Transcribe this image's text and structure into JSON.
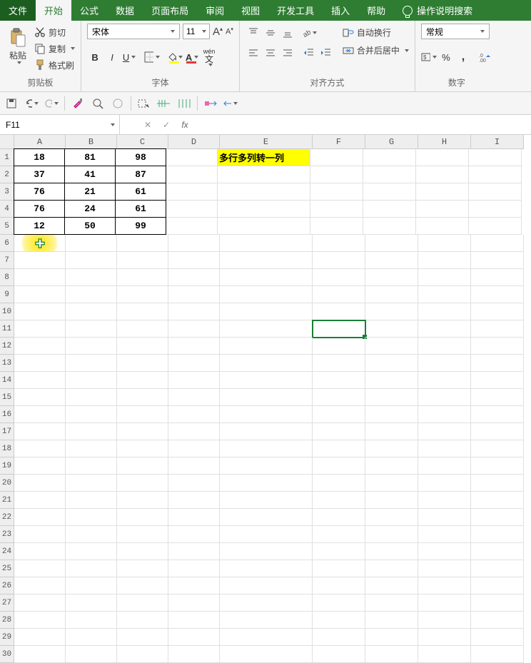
{
  "tabs": {
    "file": "文件",
    "home": "开始",
    "formula": "公式",
    "data": "数据",
    "layout": "页面布局",
    "review": "审阅",
    "view": "视图",
    "dev": "开发工具",
    "insert": "插入",
    "help": "帮助",
    "search": "操作说明搜索"
  },
  "ribbon": {
    "clipboard": {
      "paste": "粘贴",
      "cut": "剪切",
      "copy": "复制",
      "format_painter": "格式刷",
      "label": "剪贴板"
    },
    "font": {
      "name": "宋体",
      "size": "11",
      "wen": "wén",
      "label": "字体"
    },
    "align": {
      "wrap": "自动换行",
      "merge": "合并后居中",
      "label": "对齐方式"
    },
    "number": {
      "format": "常规",
      "percent": "%",
      "label": "数字"
    }
  },
  "formula_bar": {
    "cell_ref": "F11",
    "value": ""
  },
  "columns": [
    {
      "name": "A",
      "w": 72
    },
    {
      "name": "B",
      "w": 72
    },
    {
      "name": "C",
      "w": 72
    },
    {
      "name": "D",
      "w": 72
    },
    {
      "name": "E",
      "w": 130
    },
    {
      "name": "F",
      "w": 74
    },
    {
      "name": "G",
      "w": 74
    },
    {
      "name": "H",
      "w": 74
    },
    {
      "name": "I",
      "w": 74
    }
  ],
  "table_data": [
    [
      18,
      81,
      98
    ],
    [
      37,
      41,
      87
    ],
    [
      76,
      21,
      61
    ],
    [
      76,
      24,
      61
    ],
    [
      12,
      50,
      99
    ]
  ],
  "highlight_cell": {
    "ref": "E1",
    "text": "多行多列转一列"
  },
  "selected_cell": "F11",
  "cursor_cell": "A6",
  "row_count": 30
}
